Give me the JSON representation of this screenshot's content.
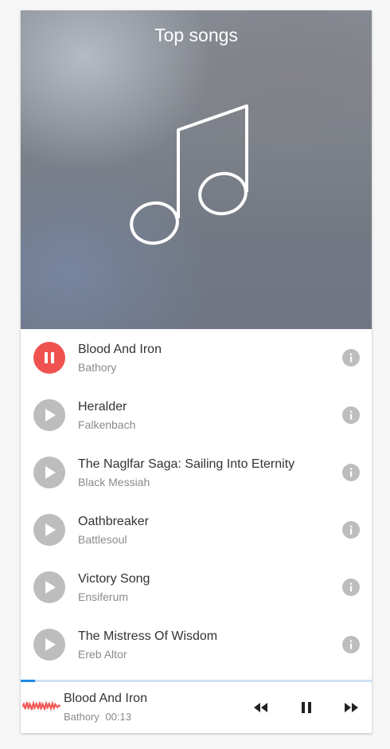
{
  "hero": {
    "title": "Top songs",
    "icon": "music-note-icon"
  },
  "songs": [
    {
      "title": "Blood And Iron",
      "artist": "Bathory",
      "state": "playing"
    },
    {
      "title": "Heralder",
      "artist": "Falkenbach",
      "state": "paused"
    },
    {
      "title": "The Naglfar Saga: Sailing Into Eternity",
      "artist": "Black Messiah",
      "state": "paused"
    },
    {
      "title": "Oathbreaker",
      "artist": "Battlesoul",
      "state": "paused"
    },
    {
      "title": "Victory Song",
      "artist": "Ensiferum",
      "state": "paused"
    },
    {
      "title": "The Mistress Of Wisdom",
      "artist": "Ereb Altor",
      "state": "paused"
    }
  ],
  "player": {
    "title": "Blood And Iron",
    "artist": "Bathory",
    "time": "00:13",
    "progress": 0.04
  },
  "colors": {
    "accent": "#ef5350",
    "progress": "#1e88e5",
    "inactive": "#bdbdbd"
  }
}
